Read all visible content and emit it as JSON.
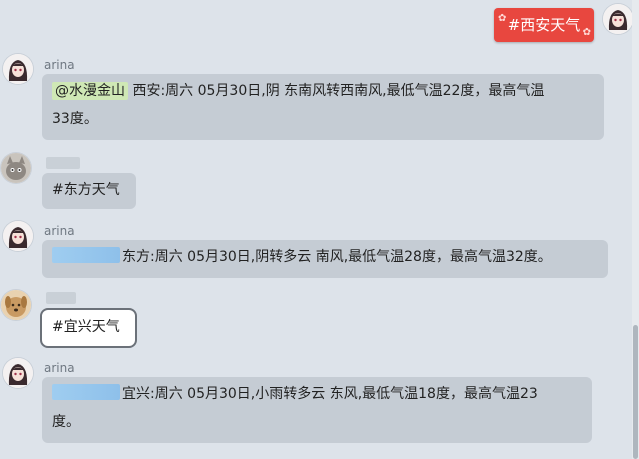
{
  "chat": {
    "outgoing": {
      "text": "#西安天气"
    },
    "messages": [
      {
        "sender": "arina",
        "mention": "@水漫金山",
        "text": " 西安:周六 05月30日,阴 东南风转西南风,最低气温22度，最高气温",
        "text2": "33度。"
      },
      {
        "text": "#东方天气"
      },
      {
        "sender": "arina",
        "text": "东方:周六 05月30日,阴转多云 南风,最低气温28度，最高气温32度。"
      },
      {
        "text": "#宜兴天气"
      },
      {
        "sender": "arina",
        "text": "宜兴:周六 05月30日,小雨转多云 东风,最低气温18度，最高气温23",
        "text2": "度。"
      }
    ]
  },
  "colors": {
    "background": "#dde3ea",
    "bubble": "#c5ccd4",
    "outgoing_bubble": "#e8473f",
    "mention_highlight": "#cfe8b5",
    "redaction": "#9fcdf0"
  },
  "icons": {
    "bot_avatar": "anime-girl-avatar",
    "self_avatar": "anime-girl-avatar",
    "user_avatar_1": "cat-avatar",
    "user_avatar_2": "dog-avatar"
  }
}
